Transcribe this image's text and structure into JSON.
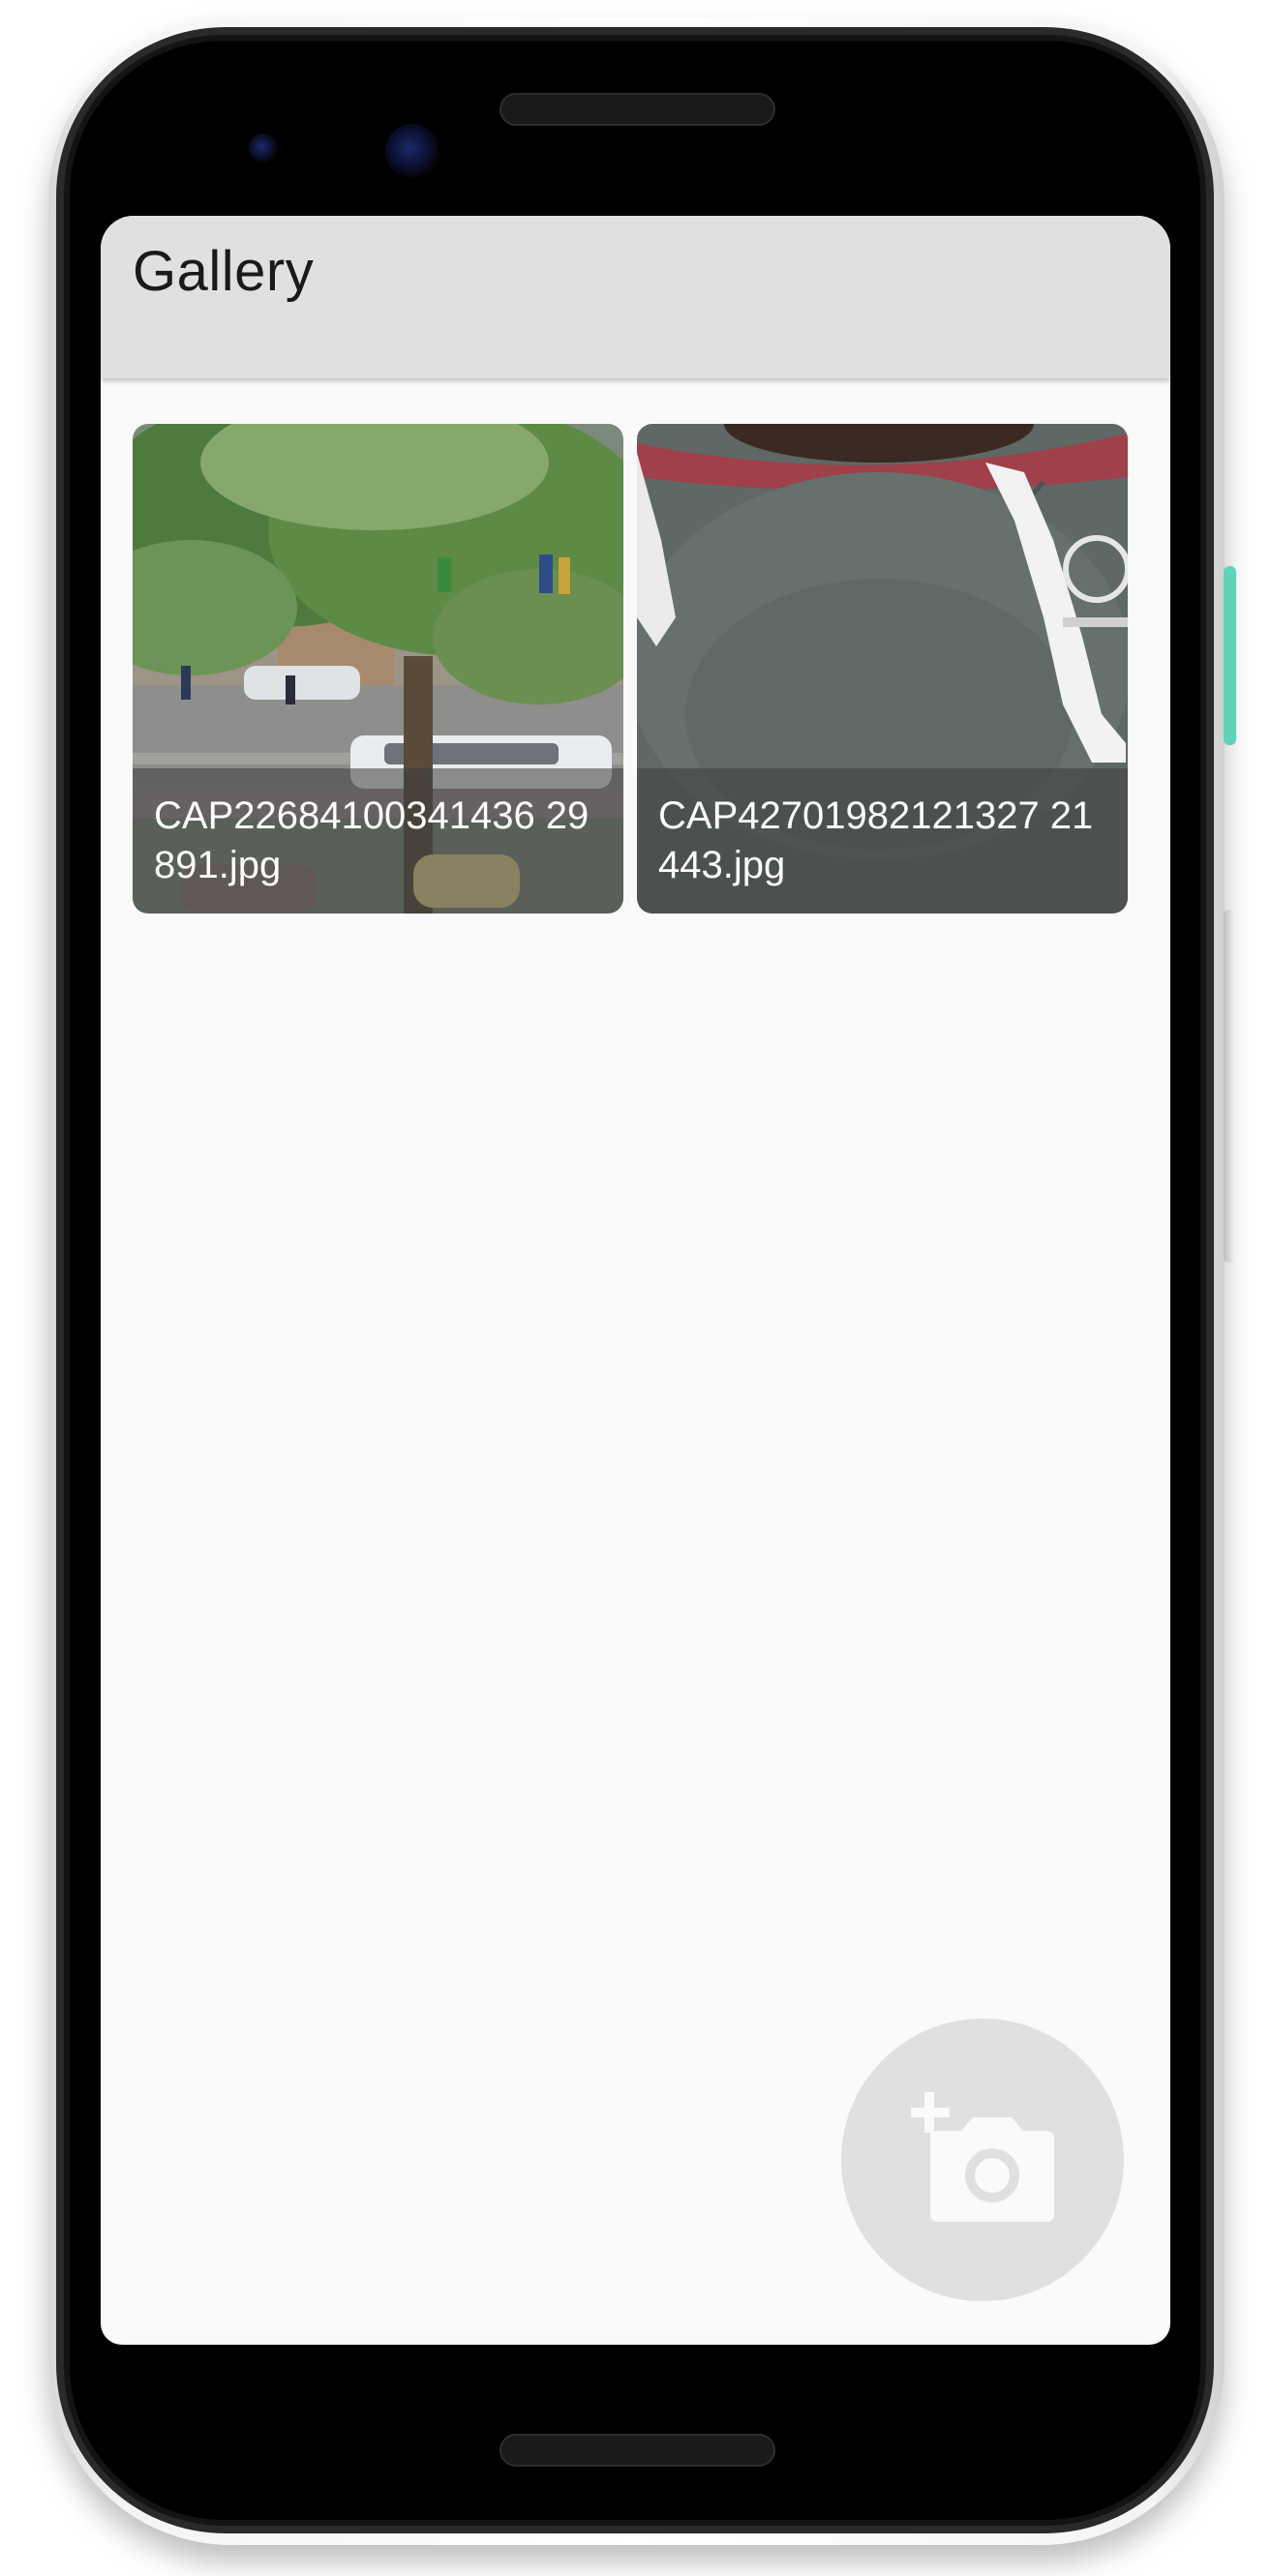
{
  "app": {
    "title": "Gallery"
  },
  "gallery": {
    "items": [
      {
        "filename": "CAP22684100341436 29891.jpg",
        "thumbnail": "street-tree-photo"
      },
      {
        "filename": "CAP42701982121327 21443.jpg",
        "thumbnail": "grey-hoodie-photo"
      }
    ]
  },
  "fab": {
    "icon": "add-a-photo-icon"
  },
  "colors": {
    "app_bar": "#e0e0e0",
    "screen_background": "#fafafa",
    "fab_background": "#e0e0e0",
    "fab_icon": "#fafafa",
    "accent_side_button": "#5dd4b8"
  }
}
